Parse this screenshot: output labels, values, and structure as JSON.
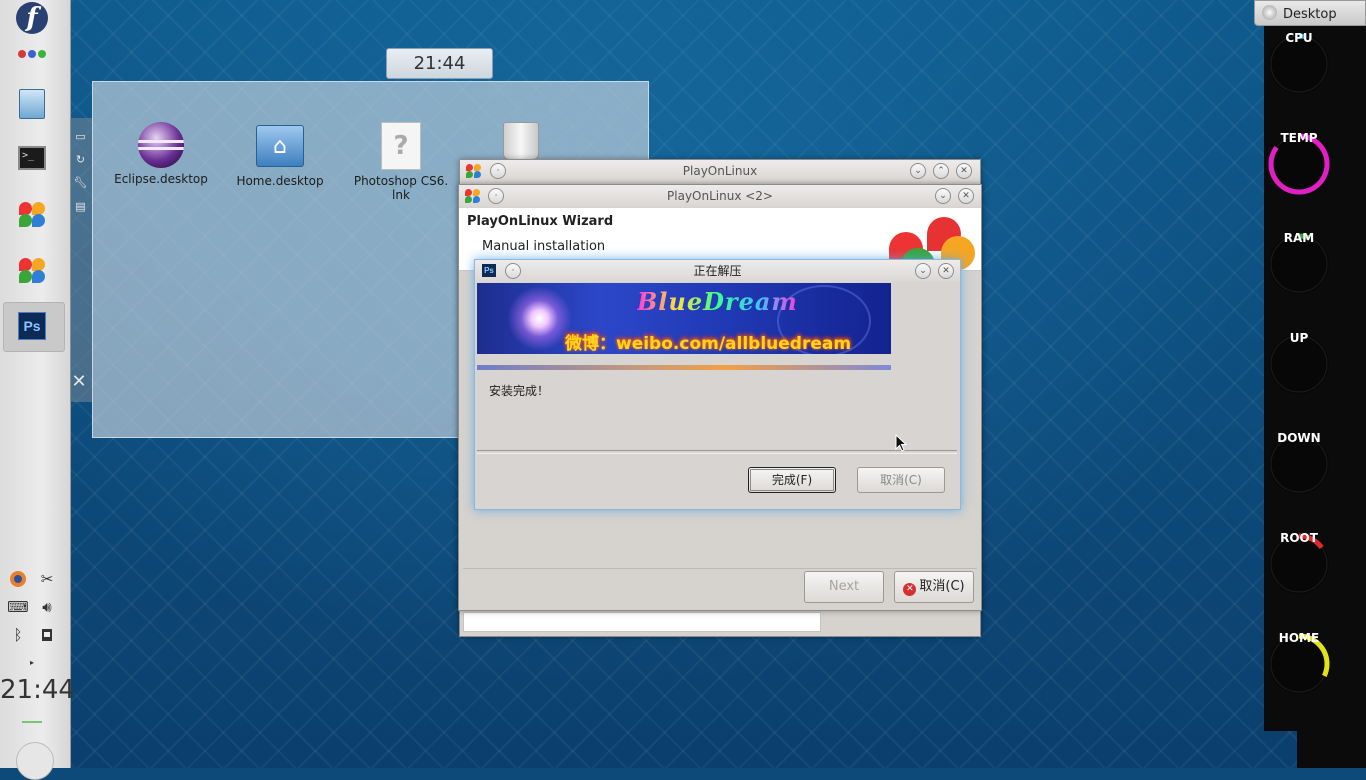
{
  "left_panel": {
    "apps": [
      {
        "name": "fedora-menu",
        "icon": "fedora-logo-icon"
      },
      {
        "name": "apps-overview",
        "icon": "color-dots-icon"
      },
      {
        "name": "file-manager",
        "icon": "file-manager-icon"
      },
      {
        "name": "terminal",
        "icon": "terminal-icon"
      },
      {
        "name": "playonlinux",
        "icon": "playonlinux-icon"
      },
      {
        "name": "playonlinux-2",
        "icon": "playonlinux-icon"
      },
      {
        "name": "photoshop",
        "icon": "photoshop-icon",
        "label": "Ps"
      }
    ],
    "terminal_glyph": ">_",
    "clock": "21:44"
  },
  "clock_tooltip": "21:44",
  "folder_view": {
    "items": [
      {
        "label": "Eclipse.desktop",
        "icon": "eclipse-icon"
      },
      {
        "label": "Home.desktop",
        "icon": "home-folder-icon"
      },
      {
        "label": "Photoshop CS6.\nlnk",
        "icon": "unknown-file-icon"
      },
      {
        "label": "",
        "icon": "trash-icon"
      }
    ],
    "unknown_glyph": "?"
  },
  "pol_main": {
    "title": "PlayOnLinux"
  },
  "pol_wizard": {
    "title": "PlayOnLinux <2>",
    "header_title": "PlayOnLinux Wizard",
    "header_subtitle": "Manual installation",
    "next_label": "Next",
    "cancel_label": "取消(C)"
  },
  "extract_dialog": {
    "title": "正在解压",
    "banner_title": "BlueDream",
    "banner_weibo": "微博：weibo.com/allbluedream",
    "status": "安装完成！",
    "finish_label": "完成(F)",
    "cancel_label": "取消(C)"
  },
  "monitor": {
    "desktop_tab": "Desktop",
    "gauges": [
      {
        "label": "CPU",
        "value": 0.04,
        "color": "#22a7e6"
      },
      {
        "label": "TEMP",
        "value": 0.85,
        "color": "#e11fc4"
      },
      {
        "label": "RAM",
        "value": 0.06,
        "color": "#3aa53a"
      },
      {
        "label": "UP",
        "value": 0.0,
        "color": "#22a7e6"
      },
      {
        "label": "DOWN",
        "value": 0.0,
        "color": "#22a7e6"
      },
      {
        "label": "ROOT",
        "value": 0.15,
        "color": "#e02a2a"
      },
      {
        "label": "HOME",
        "value": 0.32,
        "color": "#e2e21a"
      }
    ]
  },
  "colors": {
    "accent_blue": "#0d4a7a",
    "dialog_glow": "#5aaae6",
    "cancel_red": "#d3302f"
  }
}
